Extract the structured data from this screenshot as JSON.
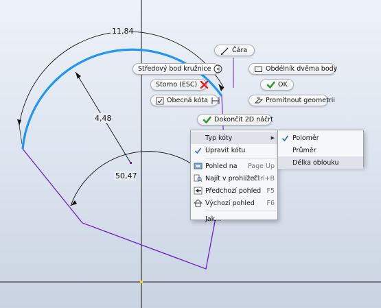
{
  "dimensions": {
    "arc_length": "11,84",
    "radius": "4,48",
    "angle": "50,47"
  },
  "toolbar": {
    "cara": "Čára",
    "stred": "Středový bod kružnice",
    "obdelnik": "Obdélník dvěma body",
    "storno": "Storno (ESC)",
    "ok": "OK",
    "obecna": "Obecná kóta",
    "promitnout": "Promítnout geometrii",
    "dokoncit": "Dokončit 2D náčrt"
  },
  "context_menu": {
    "typ_koty": "Typ kóty",
    "upravit": "Upravit kótu",
    "pohled_na": "Pohled na",
    "pohled_na_shortcut": "Page Up",
    "najit": "Najít v prohlížeči",
    "najit_shortcut": "Ctrl+B",
    "predchozi": "Předchozí pohled",
    "predchozi_shortcut": "F5",
    "vychozi": "Výchozí pohled",
    "vychozi_shortcut": "F6",
    "jak": "Jak..."
  },
  "submenu": {
    "polomer": "Poloměr",
    "prumer": "Průměr",
    "delka": "Délka oblouku"
  },
  "colors": {
    "arc": "#2196f3",
    "sketch_line": "#6a1fd0",
    "axis": "#111111",
    "ok_green": "#2a9a2a",
    "cancel_red": "#e02020"
  }
}
